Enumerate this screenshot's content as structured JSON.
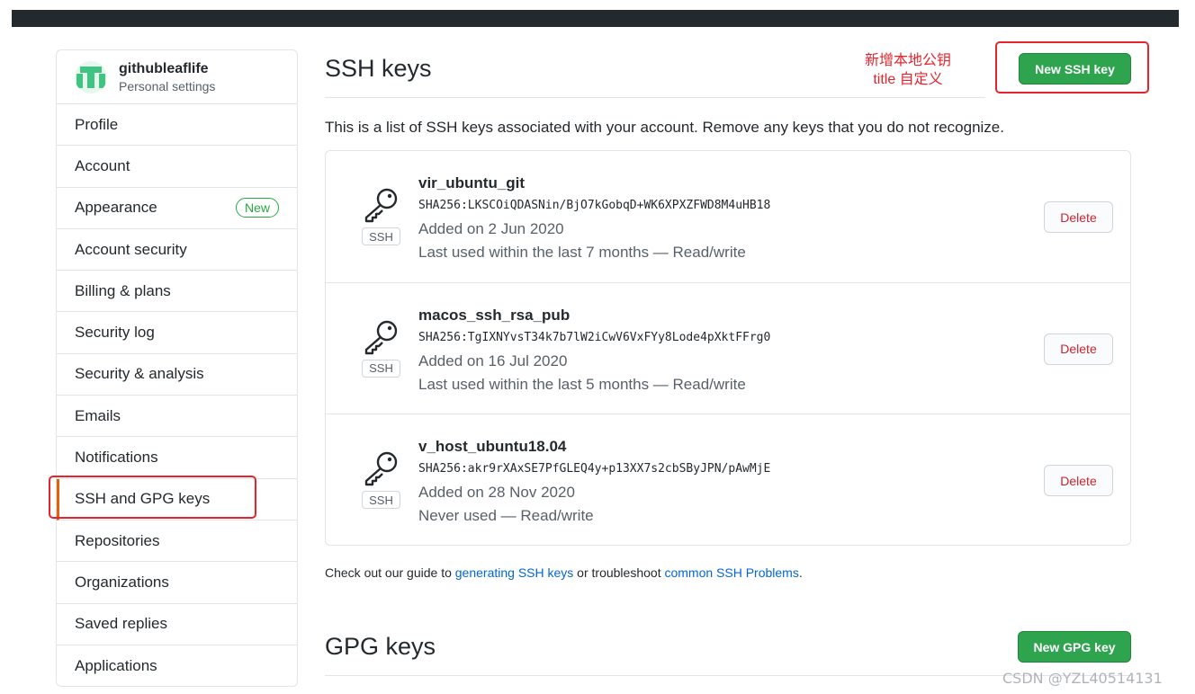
{
  "user": {
    "name": "githubleaflife",
    "subtitle": "Personal settings"
  },
  "sidebar": {
    "items": [
      {
        "label": "Profile"
      },
      {
        "label": "Account"
      },
      {
        "label": "Appearance",
        "badge": "New"
      },
      {
        "label": "Account security"
      },
      {
        "label": "Billing & plans"
      },
      {
        "label": "Security log"
      },
      {
        "label": "Security & analysis"
      },
      {
        "label": "Emails"
      },
      {
        "label": "Notifications"
      },
      {
        "label": "SSH and GPG keys",
        "selected": true
      },
      {
        "label": "Repositories"
      },
      {
        "label": "Organizations"
      },
      {
        "label": "Saved replies"
      },
      {
        "label": "Applications"
      }
    ]
  },
  "ssh": {
    "title": "SSH keys",
    "new_button": "New SSH key",
    "annotation_line1": "新增本地公钥",
    "annotation_line2": "title 自定义",
    "intro": "This is a list of SSH keys associated with your account. Remove any keys that you do not recognize.",
    "keys": [
      {
        "title": "vir_ubuntu_git",
        "fingerprint": "SHA256:LKSCOiQDASNin/BjO7kGobqD+WK6XPXZFWD8M4uHB18",
        "added": "Added on 2 Jun 2020",
        "used": "Last used within the last 7 months — Read/write",
        "type_label": "SSH",
        "delete_label": "Delete"
      },
      {
        "title": "macos_ssh_rsa_pub",
        "fingerprint": "SHA256:TgIXNYvsT34k7b7lW2iCwV6VxFYy8Lode4pXktFFrg0",
        "added": "Added on 16 Jul 2020",
        "used": "Last used within the last 5 months — Read/write",
        "type_label": "SSH",
        "delete_label": "Delete"
      },
      {
        "title": "v_host_ubuntu18.04",
        "fingerprint": "SHA256:akr9rXAxSE7PfGLEQ4y+p13XX7s2cbSByJPN/pAwMjE",
        "added": "Added on 28 Nov 2020",
        "used": "Never used — Read/write",
        "type_label": "SSH",
        "delete_label": "Delete"
      }
    ],
    "guide": {
      "prefix": "Check out our guide to ",
      "link1": "generating SSH keys",
      "middle": " or troubleshoot ",
      "link2": "common SSH Problems",
      "suffix": "."
    }
  },
  "gpg": {
    "title": "GPG keys",
    "new_button": "New GPG key"
  },
  "watermark": "CSDN @YZL40514131",
  "icons": {
    "key": "key-icon",
    "avatar": "identicon-avatar"
  },
  "colors": {
    "green": "#2ea44f",
    "danger": "#cb2431",
    "link": "#0366d6",
    "highlight": "#e5252e"
  }
}
